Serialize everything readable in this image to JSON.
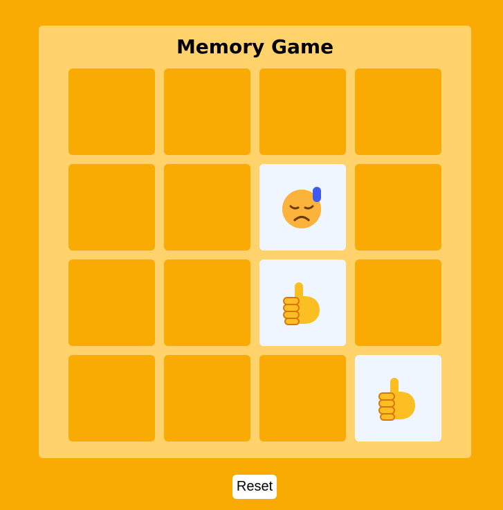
{
  "game": {
    "title": "Memory Game",
    "reset_label": "Reset",
    "rows": 4,
    "cols": 4,
    "cards": [
      {
        "revealed": false
      },
      {
        "revealed": false
      },
      {
        "revealed": false
      },
      {
        "revealed": false
      },
      {
        "revealed": false
      },
      {
        "revealed": false
      },
      {
        "revealed": true,
        "icon": "anxious-face-with-sweat-icon"
      },
      {
        "revealed": false
      },
      {
        "revealed": false
      },
      {
        "revealed": false
      },
      {
        "revealed": true,
        "icon": "thumbs-up-icon"
      },
      {
        "revealed": false
      },
      {
        "revealed": false
      },
      {
        "revealed": false
      },
      {
        "revealed": false
      },
      {
        "revealed": true,
        "icon": "thumbs-up-icon"
      }
    ]
  },
  "colors": {
    "background": "#FAAB03",
    "panel": "#FFD26C",
    "card_back": "#FAAB03",
    "card_face": "#EFF6FF"
  }
}
